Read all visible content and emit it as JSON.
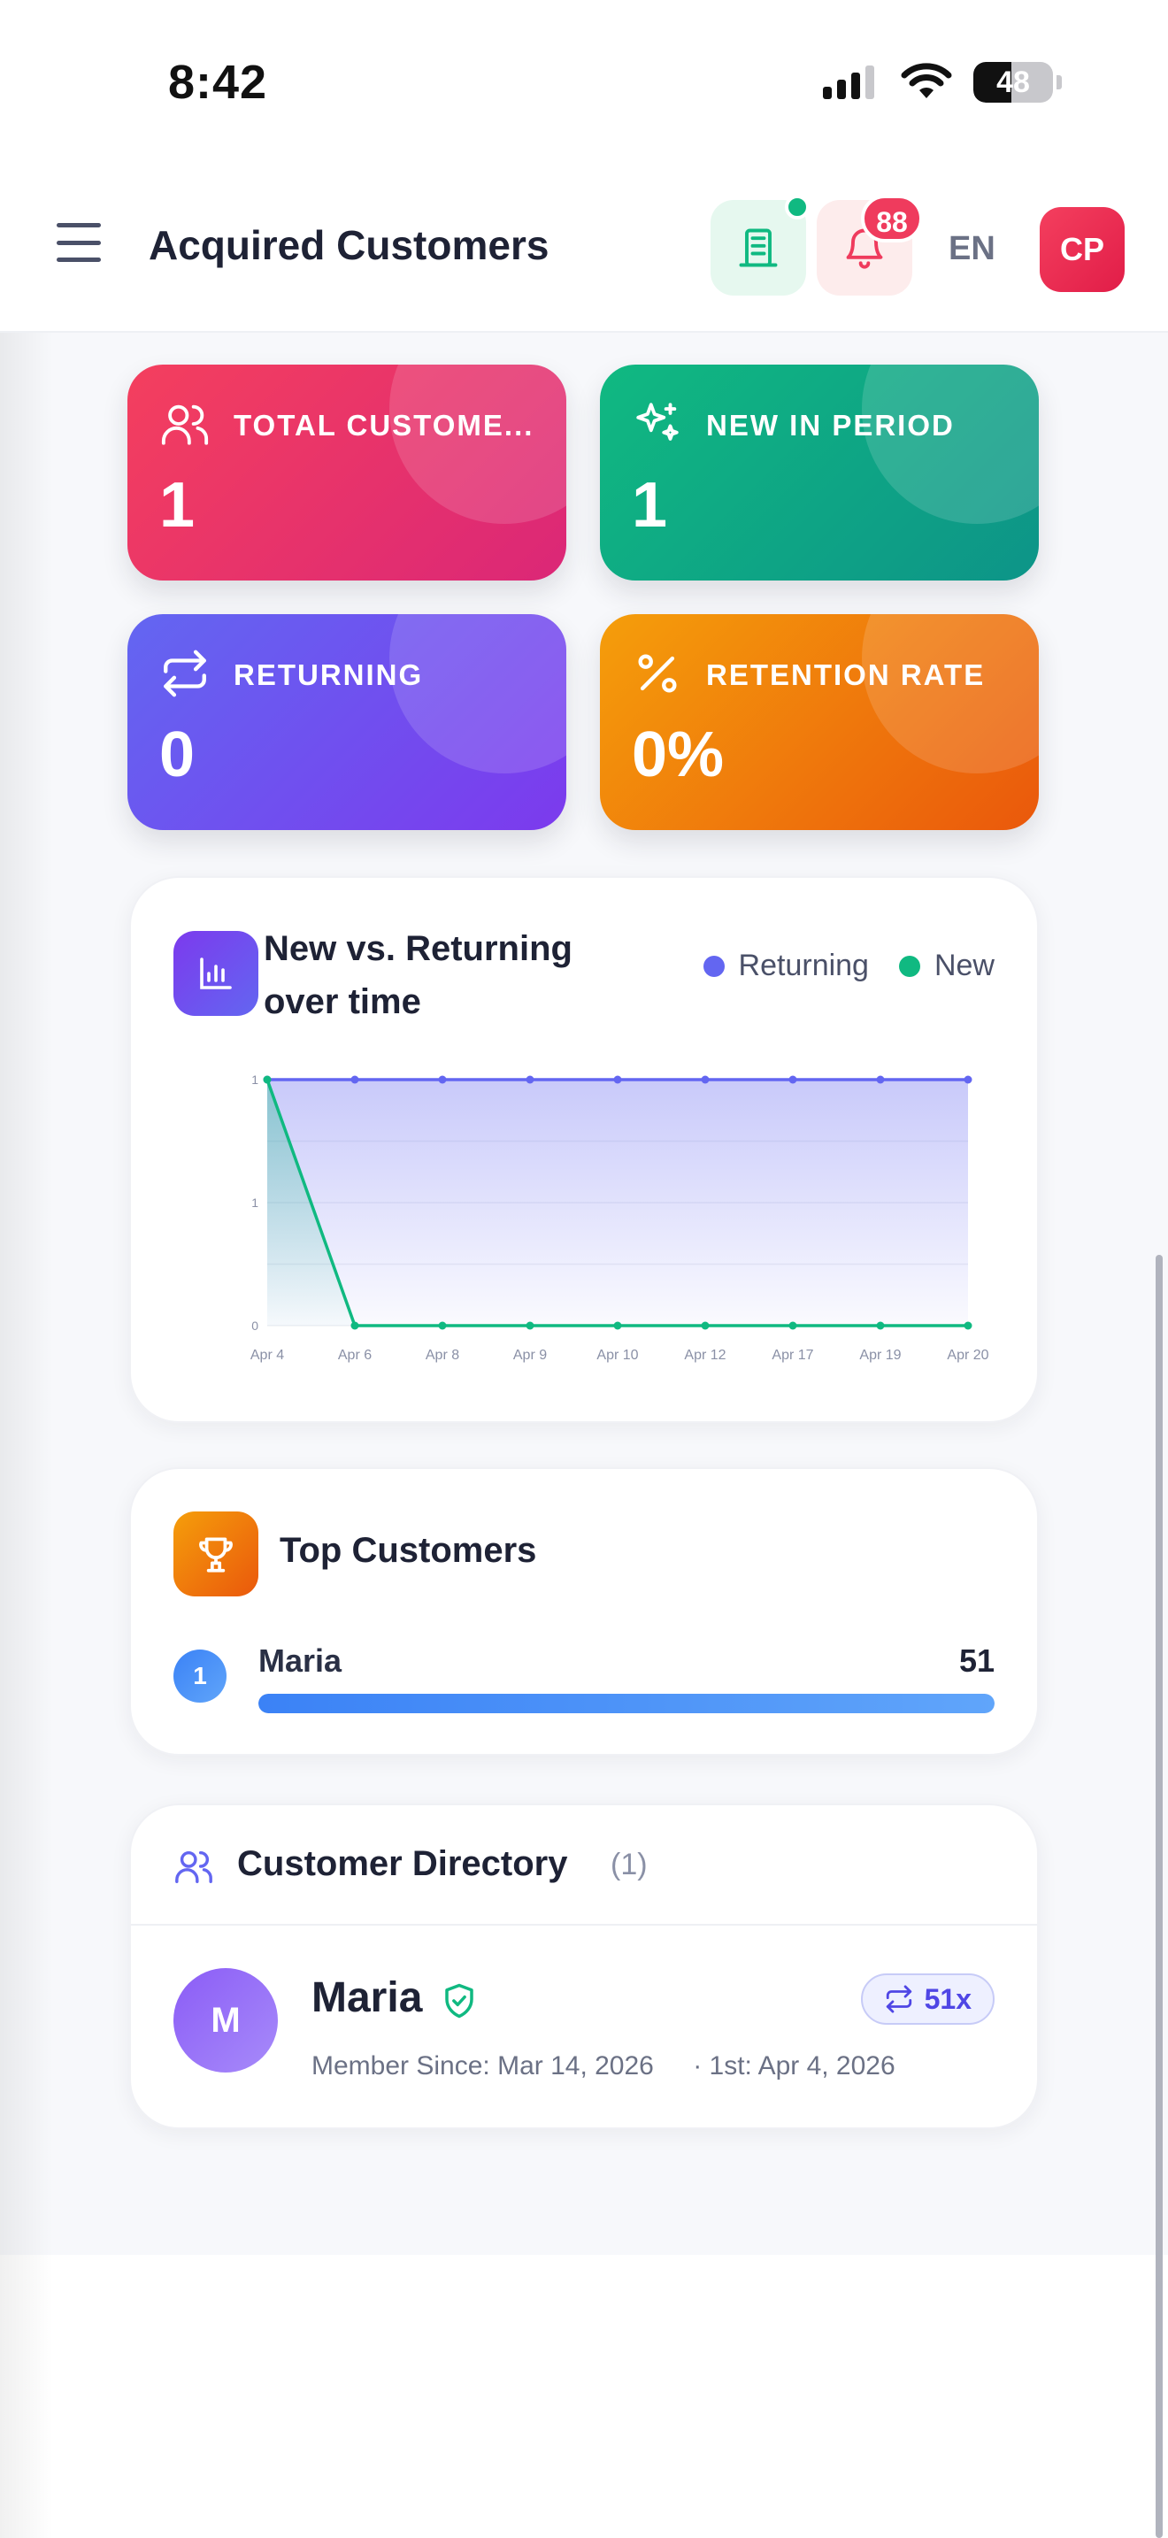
{
  "status_bar": {
    "time": "8:42",
    "battery": "48",
    "battery_level": 0.48
  },
  "header": {
    "title": "Acquired Customers",
    "notification_count": "88",
    "language": "EN",
    "user_initials": "CP"
  },
  "stats": {
    "total": {
      "label": "TOTAL CUSTOME...",
      "value": "1"
    },
    "new": {
      "label": "NEW IN PERIOD",
      "value": "1"
    },
    "returning": {
      "label": "RETURNING",
      "value": "0"
    },
    "retention": {
      "label": "RETENTION RATE",
      "value": "0%"
    }
  },
  "chart": {
    "title": "New vs. Returning over time",
    "legend": {
      "returning": "Returning",
      "new": "New"
    },
    "colors": {
      "returning": "#6366f1",
      "new": "#10b981"
    }
  },
  "chart_data": {
    "type": "area",
    "title": "New vs. Returning over time",
    "x": [
      "Apr 4",
      "Apr 6",
      "Apr 8",
      "Apr 9",
      "Apr 10",
      "Apr 12",
      "Apr 17",
      "Apr 19",
      "Apr 20"
    ],
    "y_tick_labels": [
      "0",
      "1",
      "1"
    ],
    "ylim": [
      0,
      1
    ],
    "grid": true,
    "legend_position": "top-right",
    "series": [
      {
        "name": "Returning",
        "values": [
          1,
          1,
          1,
          1,
          1,
          1,
          1,
          1,
          1
        ]
      },
      {
        "name": "New",
        "values": [
          1,
          0,
          0,
          0,
          0,
          0,
          0,
          0,
          0
        ]
      }
    ]
  },
  "top_customers": {
    "title": "Top Customers",
    "items": [
      {
        "rank": "1",
        "name": "Maria",
        "count": "51",
        "share": 1.0
      }
    ]
  },
  "directory": {
    "title": "Customer Directory",
    "count": "(1)",
    "customers": [
      {
        "initial": "M",
        "name": "Maria",
        "visits": "51x",
        "member_since": "Member Since: Mar 14, 2026",
        "first": "· 1st: Apr 4, 2026"
      }
    ]
  }
}
